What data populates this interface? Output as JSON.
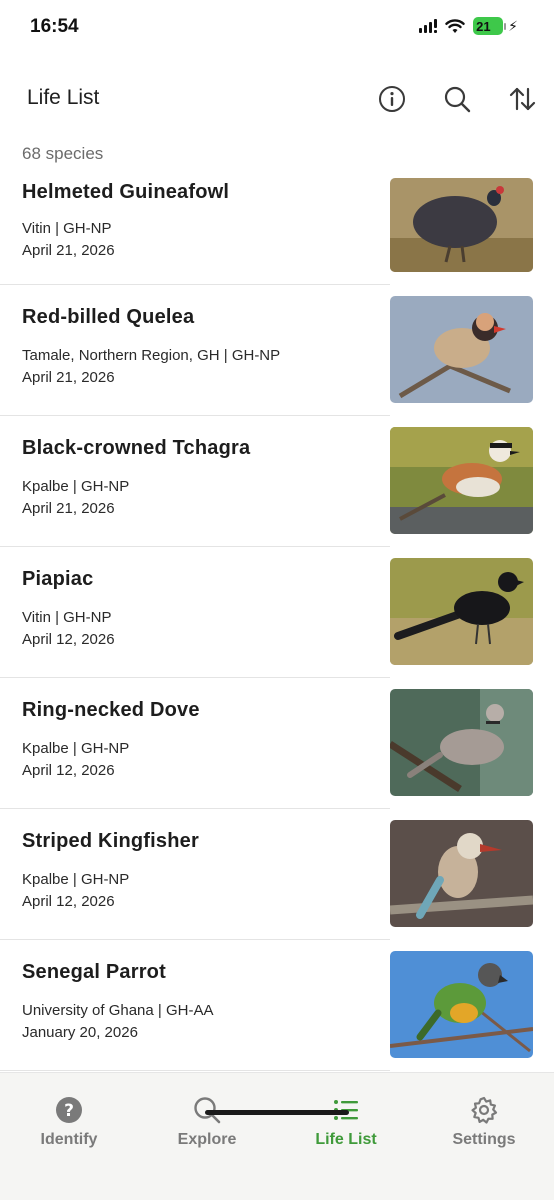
{
  "status_bar": {
    "time": "16:54",
    "battery": "21"
  },
  "header": {
    "title": "Life List"
  },
  "summary": {
    "species_count": "68 species"
  },
  "observations": [
    {
      "name": "Helmeted Guineafowl",
      "location": "Vitin | GH-NP",
      "date": "April 21, 2026"
    },
    {
      "name": "Red-billed Quelea",
      "location": "Tamale, Northern Region, GH | GH-NP",
      "date": "April 21, 2026"
    },
    {
      "name": "Black-crowned Tchagra",
      "location": "Kpalbe | GH-NP",
      "date": "April 21, 2026"
    },
    {
      "name": "Piapiac",
      "location": "Vitin | GH-NP",
      "date": "April 12, 2026"
    },
    {
      "name": "Ring-necked Dove",
      "location": "Kpalbe | GH-NP",
      "date": "April 12, 2026"
    },
    {
      "name": "Striped Kingfisher",
      "location": "Kpalbe | GH-NP",
      "date": "April 12, 2026"
    },
    {
      "name": "Senegal Parrot",
      "location": "University of Ghana | GH-AA",
      "date": "January 20, 2026"
    }
  ],
  "bottom_nav": [
    {
      "label": "Identify",
      "icon": "question-circle-icon",
      "active": false
    },
    {
      "label": "Explore",
      "icon": "search-icon",
      "active": false
    },
    {
      "label": "Life List",
      "icon": "list-icon",
      "active": true
    },
    {
      "label": "Settings",
      "icon": "gear-icon",
      "active": false
    }
  ],
  "colors": {
    "accent": "#3f9a3a",
    "inactive": "#7a7a7a",
    "nav_bg": "#f5f5f3"
  }
}
